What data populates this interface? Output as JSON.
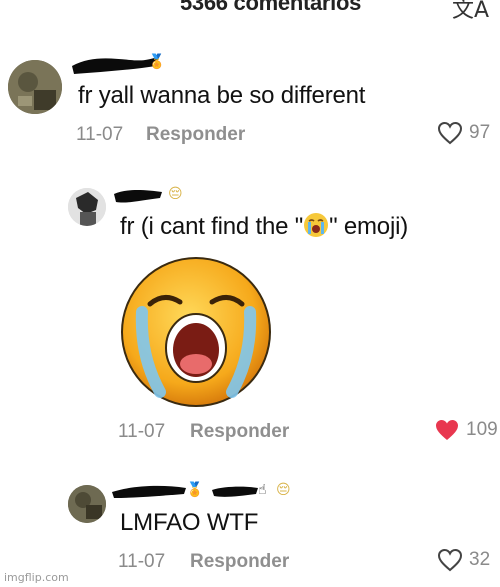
{
  "header": {
    "title": "5366 comentarios",
    "translate_icon": "translate-icon"
  },
  "comments": [
    {
      "text": "fr yall wanna be so different",
      "date": "11-07",
      "reply_label": "Responder",
      "likes": "97",
      "liked": false
    },
    {
      "text_before": "fr (i cant find the \"",
      "text_after": "\" emoji)",
      "date": "11-07",
      "reply_label": "Responder",
      "likes": "109",
      "liked": true,
      "attachment_icon": "loudly-crying-face-icon"
    },
    {
      "text": "LMFAO WTF",
      "date": "11-07",
      "reply_label": "Responder",
      "likes": "32",
      "liked": false
    }
  ],
  "colors": {
    "like_active": "#e8374f",
    "meta_gray": "#8a8a8a"
  },
  "watermark": "imgflip.com"
}
